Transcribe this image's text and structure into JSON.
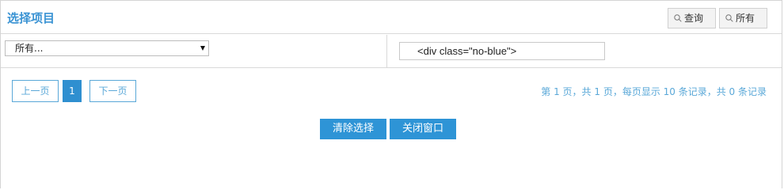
{
  "header": {
    "title": "选择项目",
    "query_label": "查询",
    "all_label": "所有"
  },
  "filter": {
    "select_value": "所有...",
    "input_value": "<div class=\"no-blue\">"
  },
  "pagination": {
    "prev_label": "上一页",
    "current_page": "1",
    "next_label": "下一页",
    "summary": "第 1 页，共 1 页，每页显示 10 条记录，共 0 条记录"
  },
  "actions": {
    "clear_label": "清除选择",
    "close_label": "关闭窗口"
  },
  "colors": {
    "accent": "#2e94d6",
    "title": "#3a93d3",
    "pager_text": "#5aa8d8"
  },
  "icons": {
    "search": "search-icon"
  }
}
